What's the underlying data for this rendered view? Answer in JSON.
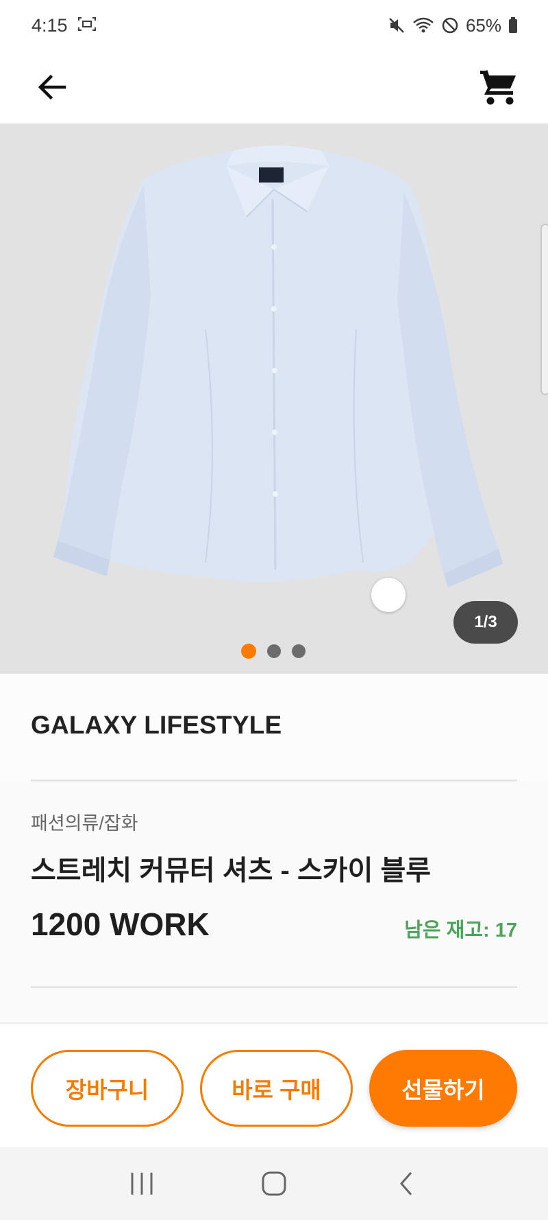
{
  "status_bar": {
    "time": "4:15",
    "battery": "65%",
    "icons": [
      "screen-capture-icon",
      "mute-icon",
      "wifi-icon",
      "do-not-disturb-icon",
      "battery-icon"
    ]
  },
  "app_bar": {
    "icons": [
      "back-arrow-icon",
      "cart-icon"
    ]
  },
  "gallery": {
    "counter": "1/3",
    "current_index": 1,
    "total": 3
  },
  "product": {
    "brand": "GALAXY LIFESTYLE",
    "category": "패션의류/잡화",
    "title": "스트레치 커뮤터 셔츠 - 스카이 블루",
    "price": "1200 WORK",
    "stock": "남은 재고: 17"
  },
  "actions": {
    "add_to_cart": "장바구니",
    "buy_now": "바로 구매",
    "gift": "선물하기"
  },
  "colors": {
    "accent": "#ff7a00",
    "stock_green": "#4ea35a"
  },
  "nav_bar": {
    "icons": [
      "recent-apps-icon",
      "home-icon",
      "back-icon"
    ]
  }
}
